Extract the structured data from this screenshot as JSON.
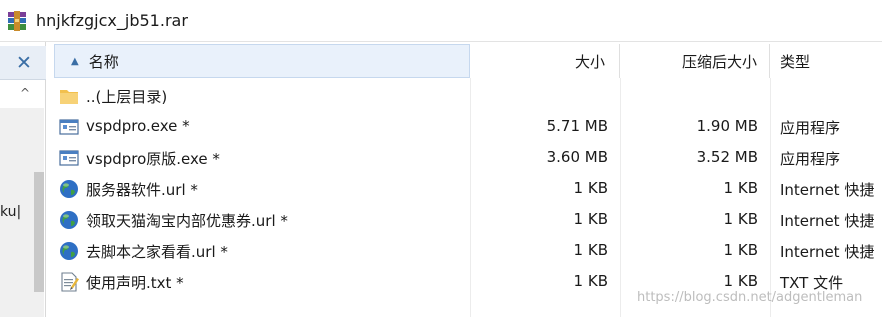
{
  "window": {
    "title": "hnjkfzgjcx_jb51.rar",
    "app_icon": "winrar-archive-icon"
  },
  "left_pane": {
    "close_symbol": "✕",
    "scroll_up_symbol": "^",
    "cut_label": "ku|"
  },
  "columns": {
    "name": "名称",
    "size": "大小",
    "packed": "压缩后大小",
    "type": "类型"
  },
  "files": [
    {
      "name": "..(上层目录)",
      "size": "",
      "packed": "",
      "type": "",
      "icon": "folder-icon"
    },
    {
      "name": "vspdpro.exe *",
      "size": "5.71 MB",
      "packed": "1.90 MB",
      "type": "应用程序",
      "icon": "exe-icon"
    },
    {
      "name": "vspdpro原版.exe *",
      "size": "3.60 MB",
      "packed": "3.52 MB",
      "type": "应用程序",
      "icon": "exe-icon"
    },
    {
      "name": "服务器软件.url *",
      "size": "1 KB",
      "packed": "1 KB",
      "type": "Internet 快捷",
      "icon": "globe-icon"
    },
    {
      "name": "领取天猫淘宝内部优惠券.url *",
      "size": "1 KB",
      "packed": "1 KB",
      "type": "Internet 快捷",
      "icon": "globe-icon"
    },
    {
      "name": "去脚本之家看看.url *",
      "size": "1 KB",
      "packed": "1 KB",
      "type": "Internet 快捷",
      "icon": "globe-icon"
    },
    {
      "name": "使用声明.txt *",
      "size": "1 KB",
      "packed": "1 KB",
      "type": "TXT 文件",
      "icon": "txt-icon"
    }
  ],
  "watermark": "https://blog.csdn.net/adgentleman"
}
